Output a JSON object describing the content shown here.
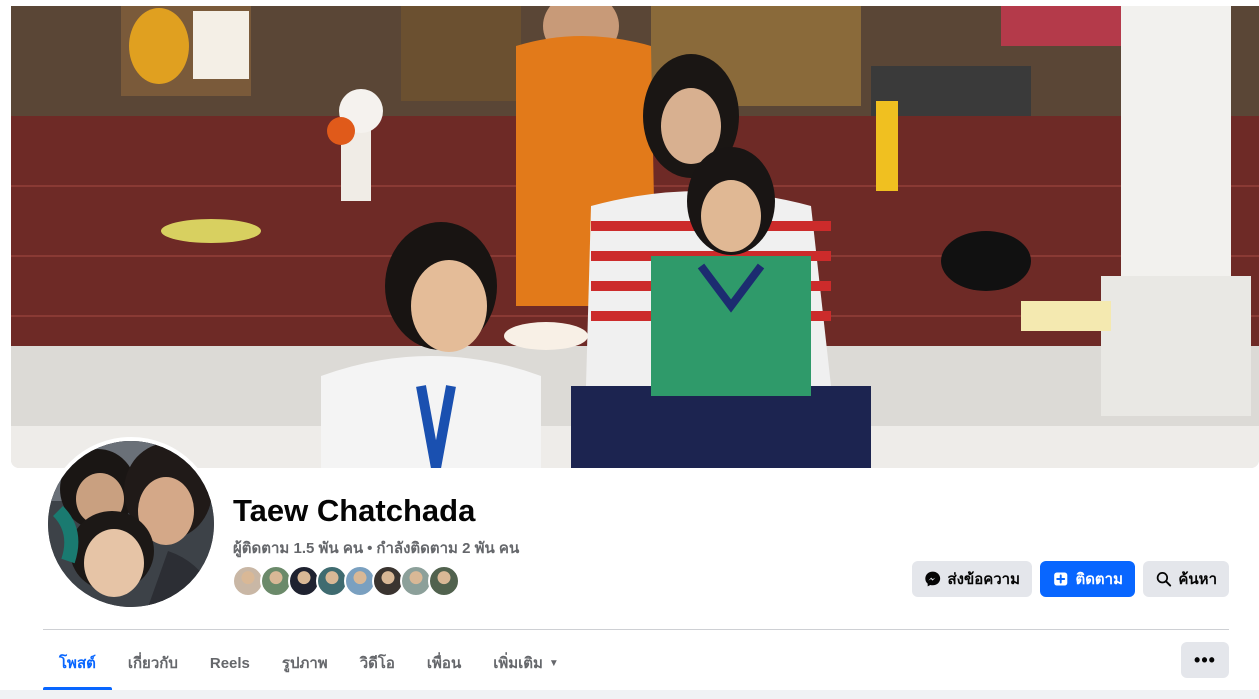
{
  "profile": {
    "name": "Taew Chatchada",
    "followers": "ผู้ติดตาม 1.5 พัน คน",
    "separator": "•",
    "following": "กำลังติดตาม 2 พัน คน"
  },
  "friends": {
    "colors": [
      "#c9b7a5",
      "#6b8a6a",
      "#1f2230",
      "#3f6b70",
      "#7aa0c0",
      "#3a3430",
      "#8ca09a",
      "#51624e"
    ]
  },
  "actions": {
    "message_label": "ส่งข้อความ",
    "follow_label": "ติดตาม",
    "search_label": "ค้นหา"
  },
  "tabs": [
    {
      "label": "โพสต์",
      "active": true
    },
    {
      "label": "เกี่ยวกับ",
      "active": false
    },
    {
      "label": "Reels",
      "active": false
    },
    {
      "label": "รูปภาพ",
      "active": false
    },
    {
      "label": "วิดีโอ",
      "active": false
    },
    {
      "label": "เพื่อน",
      "active": false
    },
    {
      "label": "เพิ่มเติม",
      "active": false
    }
  ],
  "more_menu_label": "•••",
  "colors": {
    "accent": "#0866ff",
    "secondary_text": "#65676b",
    "button_gray": "#e4e6eb"
  }
}
